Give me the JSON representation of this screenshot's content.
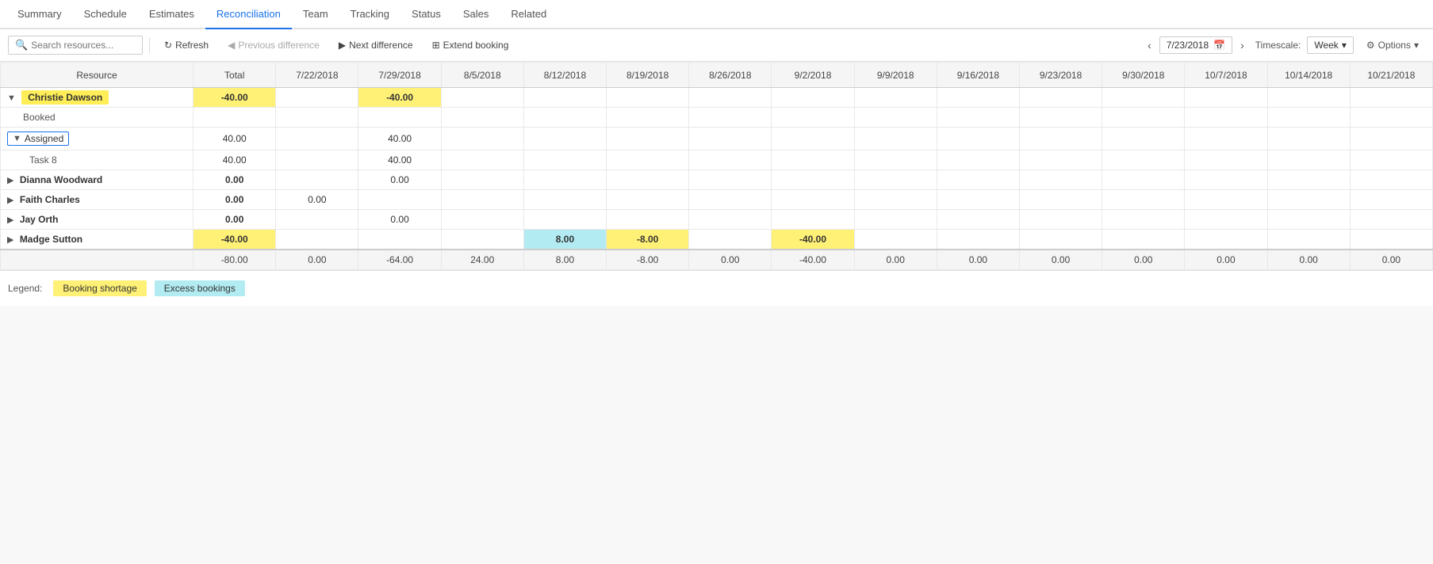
{
  "nav": {
    "items": [
      {
        "label": "Summary",
        "active": false
      },
      {
        "label": "Schedule",
        "active": false
      },
      {
        "label": "Estimates",
        "active": false
      },
      {
        "label": "Reconciliation",
        "active": true
      },
      {
        "label": "Team",
        "active": false
      },
      {
        "label": "Tracking",
        "active": false
      },
      {
        "label": "Status",
        "active": false
      },
      {
        "label": "Sales",
        "active": false
      },
      {
        "label": "Related",
        "active": false
      }
    ]
  },
  "toolbar": {
    "search_placeholder": "Search resources...",
    "refresh_label": "Refresh",
    "prev_diff_label": "Previous difference",
    "next_diff_label": "Next difference",
    "extend_booking_label": "Extend booking",
    "date_value": "7/23/2018",
    "timescale_label": "Timescale:",
    "timescale_value": "Week",
    "options_label": "Options"
  },
  "grid": {
    "headers": [
      "Resource",
      "Total",
      "7/22/2018",
      "7/29/2018",
      "8/5/2018",
      "8/12/2018",
      "8/19/2018",
      "8/26/2018",
      "9/2/2018",
      "9/9/2018",
      "9/16/2018",
      "9/23/2018",
      "9/30/2018",
      "10/7/2018",
      "10/14/2018",
      "10/21/2018"
    ],
    "rows": [
      {
        "type": "resource",
        "name": "Christie Dawson",
        "highlight": true,
        "expanded": true,
        "total": "-40.00",
        "cells": [
          "",
          "-40.00",
          "",
          "",
          "",
          "",
          "",
          "",
          "",
          "",
          "",
          "",
          "",
          "",
          ""
        ]
      },
      {
        "type": "booked",
        "name": "Booked",
        "total": "",
        "cells": [
          "",
          "",
          "",
          "",
          "",
          "",
          "",
          "",
          "",
          "",
          "",
          "",
          "",
          "",
          ""
        ]
      },
      {
        "type": "assigned",
        "name": "Assigned",
        "expanded": true,
        "total": "40.00",
        "cells": [
          "",
          "40.00",
          "",
          "",
          "",
          "",
          "",
          "",
          "",
          "",
          "",
          "",
          "",
          "",
          ""
        ]
      },
      {
        "type": "task",
        "name": "Task 8",
        "total": "40.00",
        "cells": [
          "",
          "40.00",
          "",
          "",
          "",
          "",
          "",
          "",
          "",
          "",
          "",
          "",
          "",
          "",
          ""
        ]
      },
      {
        "type": "resource",
        "name": "Dianna Woodward",
        "highlight": false,
        "expanded": false,
        "total": "0.00",
        "cells": [
          "",
          "0.00",
          "",
          "",
          "",
          "",
          "",
          "",
          "",
          "",
          "",
          "",
          "",
          "",
          ""
        ]
      },
      {
        "type": "resource",
        "name": "Faith Charles",
        "highlight": false,
        "expanded": false,
        "total": "0.00",
        "cells": [
          "0.00",
          "",
          "",
          "",
          "",
          "",
          "",
          "",
          "",
          "",
          "",
          "",
          "",
          "",
          ""
        ]
      },
      {
        "type": "resource",
        "name": "Jay Orth",
        "highlight": false,
        "expanded": false,
        "total": "0.00",
        "cells": [
          "",
          "0.00",
          "",
          "",
          "",
          "",
          "",
          "",
          "",
          "",
          "",
          "",
          "",
          "",
          ""
        ]
      },
      {
        "type": "resource",
        "name": "Madge Sutton",
        "highlight": false,
        "expanded": false,
        "total": "-40.00",
        "cells": [
          "",
          "",
          "",
          "8.00",
          "-8.00",
          "",
          "-40.00",
          "",
          "",
          "",
          "",
          "",
          "",
          "",
          ""
        ],
        "cell_types": [
          "",
          "",
          "",
          "cyan",
          "yellow",
          "",
          "yellow2",
          "",
          "",
          "",
          "",
          "",
          "",
          "",
          ""
        ]
      }
    ],
    "totals": [
      "-80.00",
      "0.00",
      "-64.00",
      "24.00",
      "8.00",
      "-8.00",
      "0.00",
      "-40.00",
      "0.00",
      "0.00",
      "0.00",
      "0.00",
      "0.00",
      "0.00",
      "0.00"
    ]
  },
  "legend": {
    "label": "Legend:",
    "booking_shortage": "Booking shortage",
    "excess_bookings": "Excess bookings"
  }
}
